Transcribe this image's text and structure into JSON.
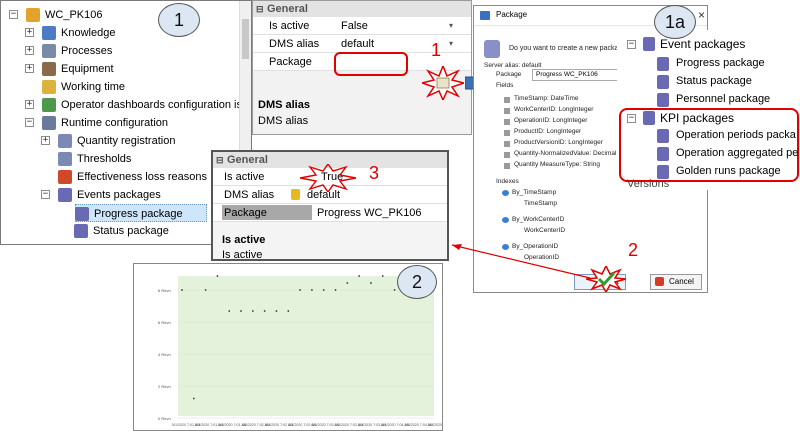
{
  "tree": {
    "items": [
      {
        "label": "WC_PK106",
        "exp": "−",
        "icon": "user-icon",
        "color": "#e2a32c"
      },
      {
        "label": "Knowledge",
        "exp": "+",
        "icon": "knowledge-icon",
        "color": "#4a7cc4"
      },
      {
        "label": "Processes",
        "exp": "+",
        "icon": "gear-icon",
        "color": "#7a8aa8"
      },
      {
        "label": "Equipment",
        "exp": "+",
        "icon": "equipment-icon",
        "color": "#8a6a4a"
      },
      {
        "label": "Working time",
        "exp": "",
        "icon": "clock-icon",
        "color": "#d9b33c"
      },
      {
        "label": "Operator dashboards configuration is",
        "exp": "+",
        "icon": "dashboard-icon",
        "color": "#4a9a4a"
      },
      {
        "label": "Runtime configuration",
        "exp": "−",
        "icon": "runtime-gear-icon",
        "color": "#6a7a9a"
      },
      {
        "label": "Quantity registration",
        "exp": "+",
        "icon": "quantity-icon",
        "color": "#7a8ab4"
      },
      {
        "label": "Thresholds",
        "exp": "",
        "icon": "thresholds-icon",
        "color": "#7a8ab4"
      },
      {
        "label": "Effectiveness loss reasons",
        "exp": "",
        "icon": "loss-reasons-icon",
        "color": "#d04a2a"
      },
      {
        "label": "Events packages",
        "exp": "−",
        "icon": "database-icon",
        "color": "#6a6ab4"
      },
      {
        "label": "Progress package",
        "exp": "",
        "icon": "package-icon",
        "color": "#6a6ab4",
        "selected": true
      },
      {
        "label": "Status package",
        "exp": "",
        "icon": "package-icon",
        "color": "#6a6ab4"
      }
    ]
  },
  "props": {
    "group": "General",
    "rows": [
      {
        "key": "Is active",
        "value": "False"
      },
      {
        "key": "DMS alias",
        "value": "default"
      },
      {
        "key": "Package",
        "value": ""
      }
    ],
    "desc_title": "DMS alias",
    "desc_text": "DMS alias"
  },
  "props2": {
    "group": "General",
    "rows": [
      {
        "key": "Is active",
        "value": "True"
      },
      {
        "key": "DMS alias",
        "value": "default"
      },
      {
        "key": "Package",
        "value": "Progress WC_PK106"
      }
    ],
    "desc_title": "Is active",
    "desc_text": "Is active"
  },
  "dialog": {
    "title": "Package",
    "question": "Do you want to create a new package",
    "server_alias": "Server alias: default",
    "package_label": "Package",
    "package_value": "Progress WC_PK106",
    "fields_label": "Fields",
    "fields": [
      "TimeStamp: DateTime",
      "WorkCenterID: LongInteger",
      "OperationID: LongInteger",
      "ProductID: LongInteger",
      "ProductVersionID: LongInteger",
      "Quantity-NormalizedValue: Decimal",
      "Quantity MeasureType: String"
    ],
    "indexes_label": "Indexes",
    "indexes": [
      {
        "name": "By_TimeStamp",
        "col": "TimeStamp"
      },
      {
        "name": "By_WorkCenterID",
        "col": "WorkCenterID"
      },
      {
        "name": "By_OperationID",
        "col": "OperationID"
      }
    ],
    "ok": "OK",
    "cancel": "Cancel"
  },
  "tree2": {
    "group1": "Event packages",
    "items1": [
      "Progress package",
      "Status package",
      "Personnel package"
    ],
    "group2": "KPI packages",
    "items2": [
      "Operation periods packa",
      "Operation aggregated pe",
      "Golden runs package"
    ],
    "footer": "Versions"
  },
  "callouts": {
    "c1": "1",
    "c1a": "1a",
    "c2": "2",
    "r1": "1",
    "r2": "2",
    "r3": "3"
  },
  "colors": {
    "accent_red": "#e00000",
    "selection": "#cde6fb",
    "chart_fill": "#e4f2dc"
  },
  "chart_data": {
    "type": "scatter",
    "title": "",
    "xlabel": "",
    "ylabel": "",
    "ytick_labels": [
      "6 Revn",
      "6 Revn",
      "4 Revn",
      "2 Revn",
      "0 Revn"
    ],
    "xtick_labels": [
      "5/1/2020 7:01 AM",
      "5/1/2020 7:01 AM",
      "5/1/2020 7:01 AM",
      "5/1/2020 7:02 AM",
      "5/1/2020 7:02 AM",
      "5/1/2020 7:02 AM",
      "5/1/2020 7:03 AM",
      "5/1/2020 7:03 AM",
      "5/1/2020 7:03 AM",
      "5/1/2020 7:04 AM",
      "5/1/2020 7:04 AM",
      "5/1/2020 7:04 AM"
    ],
    "ylim": [
      0,
      8
    ],
    "series": [
      {
        "values": [
          7.2,
          1.0,
          7.2,
          8.0,
          6.0,
          6.0,
          6.0,
          6.0,
          6.0,
          6.0,
          7.2,
          7.2,
          7.2,
          7.2,
          7.6,
          8.0,
          7.6,
          8.0,
          7.2,
          7.2,
          7.6,
          7.6
        ]
      }
    ]
  }
}
